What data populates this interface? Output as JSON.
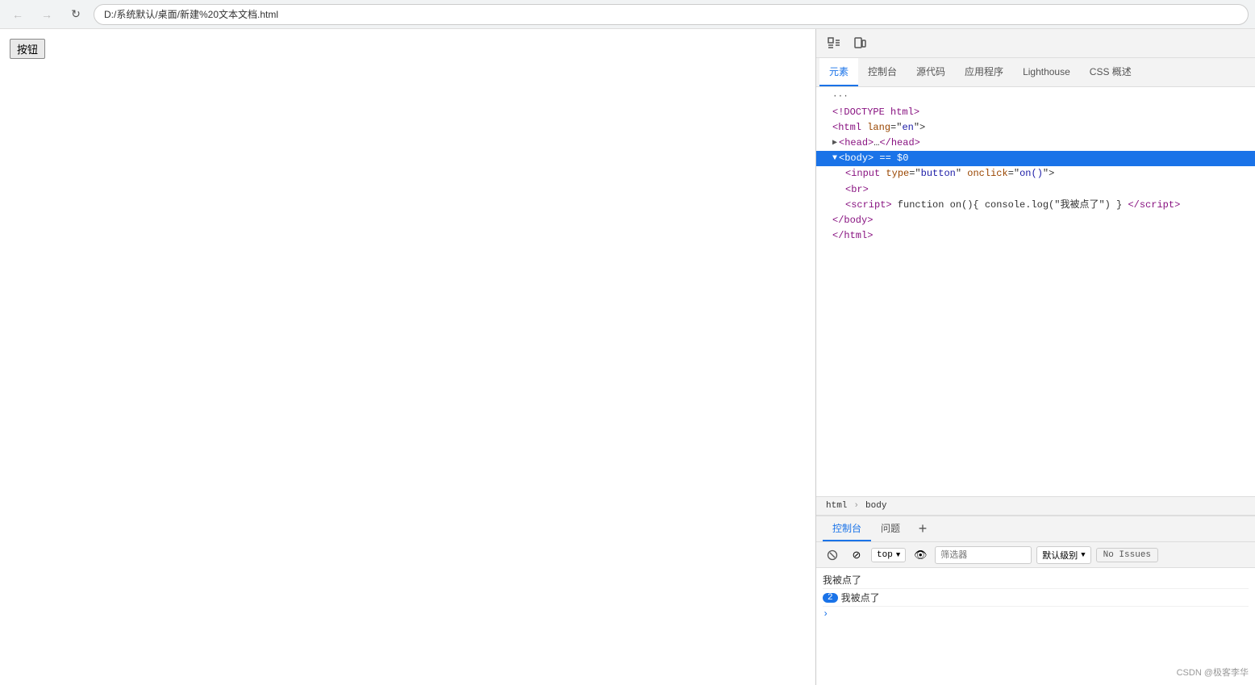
{
  "browser": {
    "back_disabled": true,
    "forward_disabled": true,
    "refresh_label": "↻",
    "address": "D:/系统默认/桌面/新建%20文本文档.html",
    "page_button_label": "按钮"
  },
  "devtools": {
    "toolbar_icons": [
      {
        "name": "inspect-icon",
        "symbol": "⬜",
        "title": "检查元素"
      },
      {
        "name": "device-icon",
        "symbol": "📱",
        "title": "设备模拟"
      }
    ],
    "tabs": [
      {
        "label": "元素",
        "active": true
      },
      {
        "label": "控制台",
        "active": false
      },
      {
        "label": "源代码",
        "active": false
      },
      {
        "label": "应用程序",
        "active": false
      },
      {
        "label": "Lighthouse",
        "active": false
      },
      {
        "label": "CSS 概述",
        "active": false
      }
    ],
    "html_lines": [
      {
        "id": "doctype",
        "indent": 1,
        "text": "<!DOCTYPE html>",
        "tag_part": "<!DOCTYPE html>"
      },
      {
        "id": "html-open",
        "indent": 1,
        "text": "<html lang=\"en\">"
      },
      {
        "id": "head",
        "indent": 1,
        "text": "▶ <head>…</head>",
        "collapsed": true
      },
      {
        "id": "body-open",
        "indent": 1,
        "text": "▼ <body> == $0",
        "selected": true,
        "has_eq": true
      },
      {
        "id": "input-line",
        "indent": 2,
        "text": "<input type=\"button\" onclick=\"on()\">"
      },
      {
        "id": "br-line",
        "indent": 2,
        "text": "<br>"
      },
      {
        "id": "script-line",
        "indent": 2,
        "text": "<script> function on(){ console.log(\"我被点了\") } </script>"
      },
      {
        "id": "body-close",
        "indent": 1,
        "text": "</body>"
      },
      {
        "id": "html-close",
        "indent": 1,
        "text": "</html>"
      }
    ],
    "breadcrumb": {
      "items": [
        "html",
        "body"
      ]
    }
  },
  "console": {
    "tabs": [
      {
        "label": "控制台",
        "active": true
      },
      {
        "label": "问题",
        "active": false
      }
    ],
    "toolbar": {
      "context_label": "top",
      "filter_placeholder": "筛选器",
      "level_label": "默认级别",
      "no_issues_label": "No Issues"
    },
    "lines": [
      {
        "text": "我被点了",
        "type": "normal"
      },
      {
        "text": "我被点了",
        "type": "counted",
        "count": "2"
      },
      {
        "type": "prompt"
      }
    ]
  },
  "watermark": "CSDN @极客李华"
}
